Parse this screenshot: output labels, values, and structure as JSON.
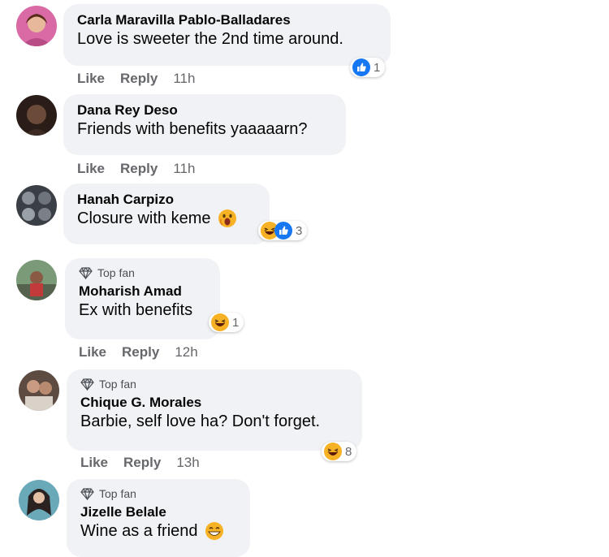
{
  "comments": [
    {
      "name": "Carla Maravilla Pablo-Balladares",
      "text": "Love is sweeter the 2nd time around.",
      "top_fan": "",
      "like": "Like",
      "reply": "Reply",
      "time": "11h",
      "reaction_count": "1"
    },
    {
      "name": "Dana Rey Deso",
      "text": "Friends with benefits yaaaaarn?",
      "top_fan": "",
      "like": "Like",
      "reply": "Reply",
      "time": "11h",
      "reaction_count": ""
    },
    {
      "name": "Hanah Carpizo",
      "text": "Closure with keme",
      "top_fan": "",
      "like": "",
      "reply": "",
      "time": "",
      "reaction_count": "3"
    },
    {
      "name": "Moharish Amad",
      "text": "Ex with benefits",
      "top_fan": "Top fan",
      "like": "Like",
      "reply": "Reply",
      "time": "12h",
      "reaction_count": "1"
    },
    {
      "name": "Chique G. Morales",
      "text": "Barbie, self love ha? Don't forget.",
      "top_fan": "Top fan",
      "like": "Like",
      "reply": "Reply",
      "time": "13h",
      "reaction_count": "8"
    },
    {
      "name": "Jizelle Belale",
      "text": "Wine as a friend",
      "top_fan": "Top fan",
      "like": "",
      "reply": "",
      "time": "",
      "reaction_count": ""
    }
  ],
  "colors": {
    "bubble": "#f0f2f5",
    "like_blue": "#1877f2",
    "haha_yellow": "#f7b125",
    "meta_text": "#65676b"
  }
}
